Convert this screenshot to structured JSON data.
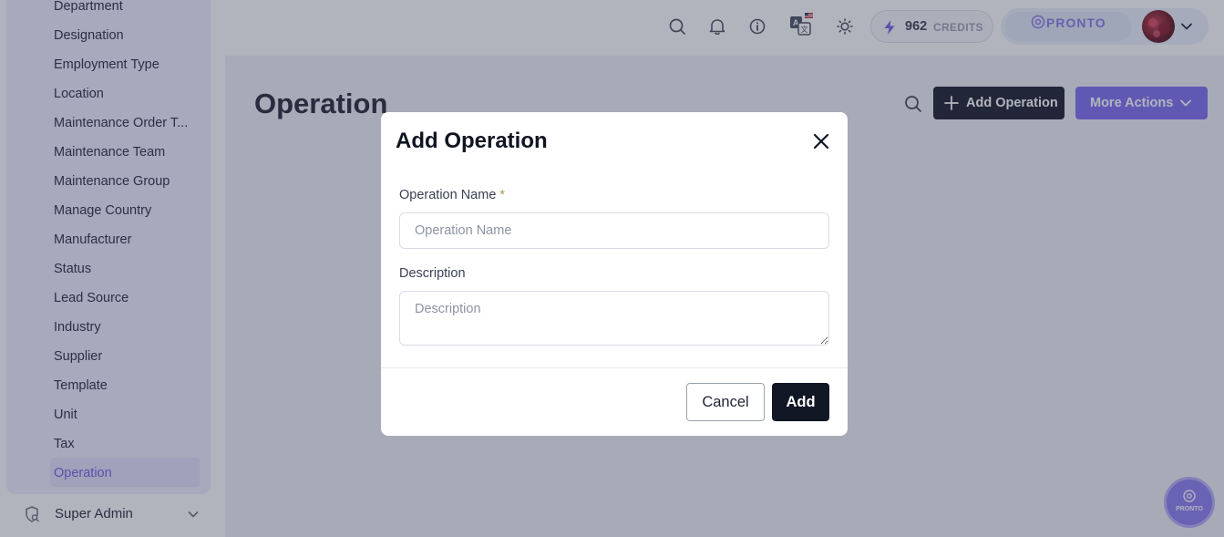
{
  "sidebar": {
    "items": [
      {
        "label": "Department"
      },
      {
        "label": "Designation"
      },
      {
        "label": "Employment Type"
      },
      {
        "label": "Location"
      },
      {
        "label": "Maintenance Order T..."
      },
      {
        "label": "Maintenance Team"
      },
      {
        "label": "Maintenance Group"
      },
      {
        "label": "Manage Country"
      },
      {
        "label": "Manufacturer"
      },
      {
        "label": "Status"
      },
      {
        "label": "Lead Source"
      },
      {
        "label": "Industry"
      },
      {
        "label": "Supplier"
      },
      {
        "label": "Template"
      },
      {
        "label": "Unit"
      },
      {
        "label": "Tax"
      },
      {
        "label": "Operation"
      }
    ],
    "active_item": "Operation",
    "super_admin_label": "Super Admin"
  },
  "header": {
    "icons": [
      "search-icon",
      "bell-icon",
      "info-icon",
      "translate-icon",
      "sun-icon"
    ],
    "credits_value": "962",
    "credits_label": "CREDITS",
    "brand_name": "PRONTO"
  },
  "page": {
    "title": "Operation",
    "add_button_label": "Add Operation",
    "more_actions_label": "More Actions"
  },
  "modal": {
    "title": "Add Operation",
    "name_label": "Operation Name",
    "name_required_mark": "*",
    "name_placeholder": "Operation Name",
    "description_label": "Description",
    "description_placeholder": "Description",
    "cancel_label": "Cancel",
    "add_label": "Add"
  },
  "fab": {
    "label": "PRONTO"
  },
  "colors": {
    "accent": "#7b6cf0",
    "primary_dark": "#161b2b",
    "active_text": "#6d5ee6"
  }
}
